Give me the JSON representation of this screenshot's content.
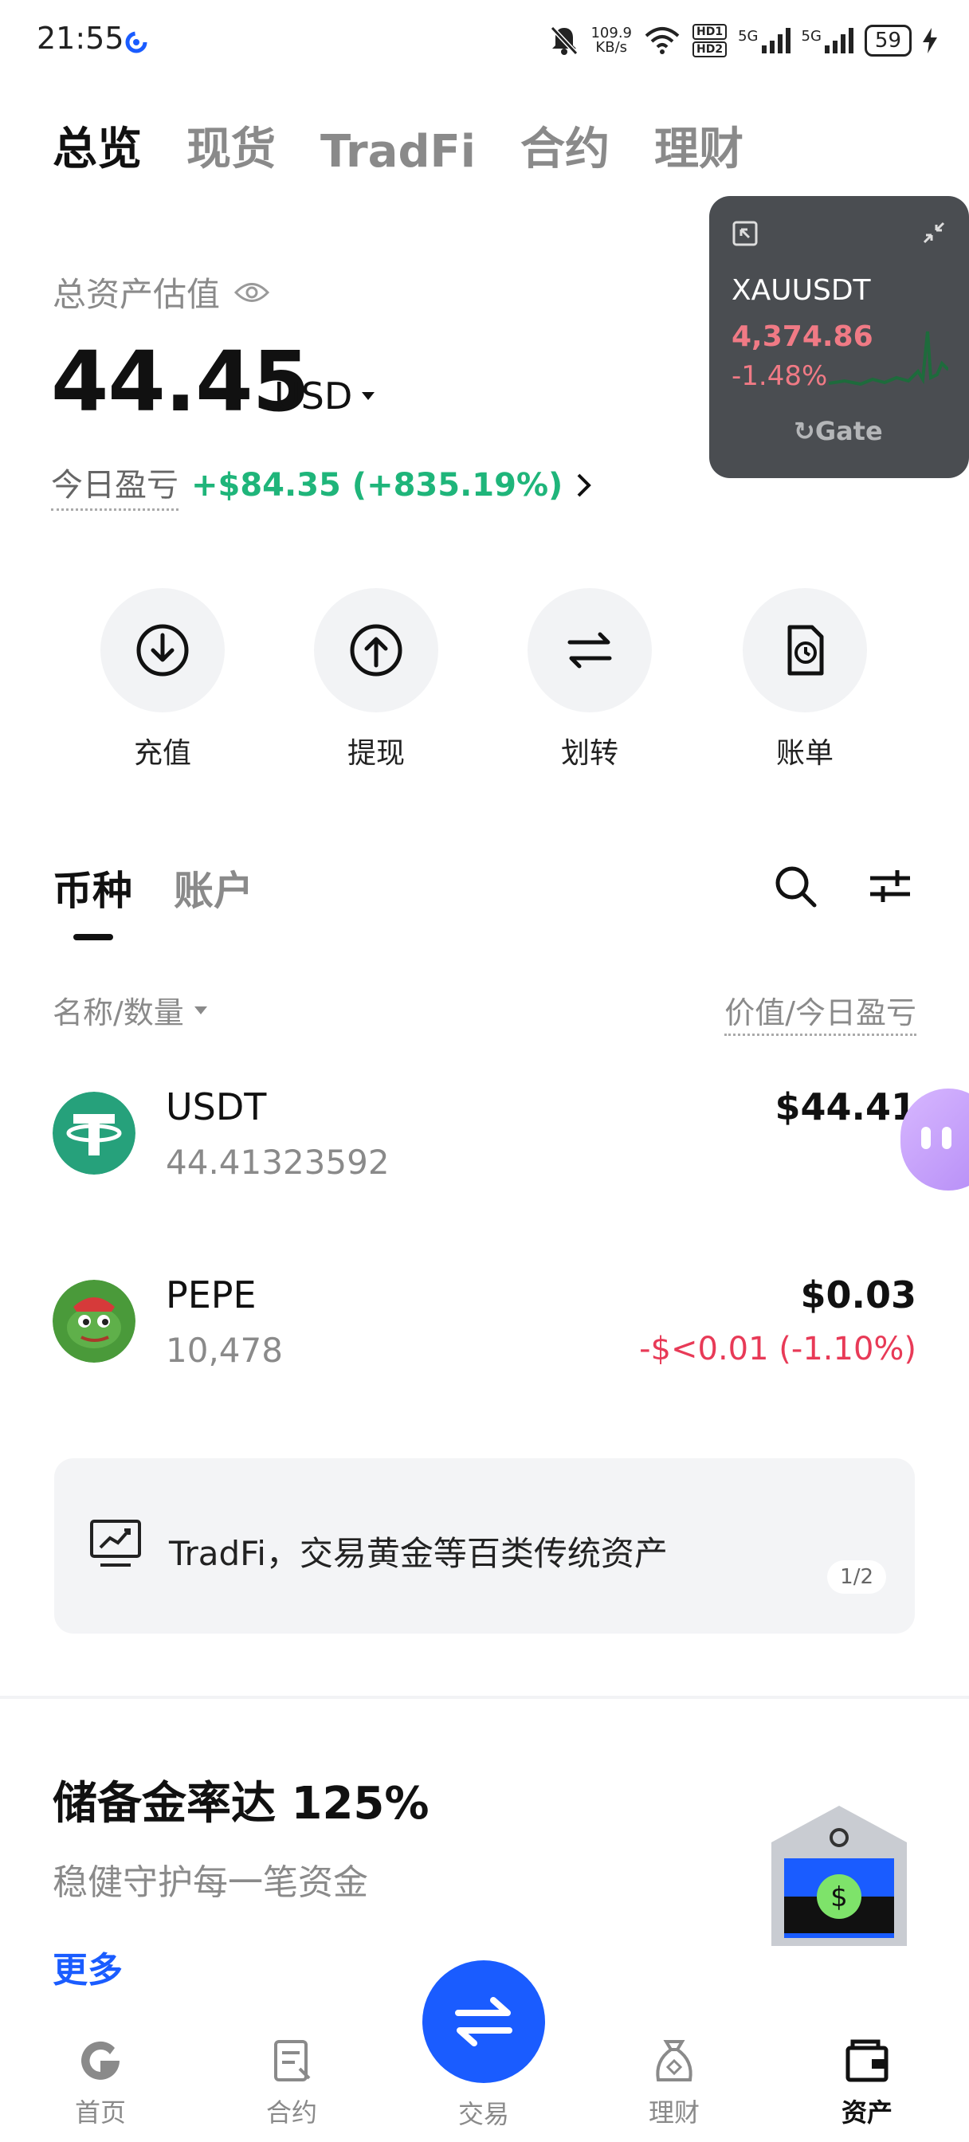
{
  "status_bar": {
    "time": "21:55",
    "net_speed_value": "109.9",
    "net_speed_unit": "KB/s",
    "hd1": "HD1",
    "hd2": "HD2",
    "sig1": "5G",
    "sig2": "5G",
    "battery": "59"
  },
  "top_tabs": [
    {
      "label": "总览",
      "active": true
    },
    {
      "label": "现货"
    },
    {
      "label": "TradFi"
    },
    {
      "label": "合约"
    },
    {
      "label": "理财"
    }
  ],
  "summary": {
    "label": "总资产估值",
    "value": "44.45",
    "currency": "USD",
    "pnl_label": "今日盈亏",
    "pnl_value": "+$84.35 (+835.19%)"
  },
  "ticker": {
    "pair": "XAUUSDT",
    "price": "4,374.86",
    "change": "-1.48%",
    "brand": "Gate"
  },
  "quick_actions": [
    {
      "label": "充值",
      "icon": "deposit-icon"
    },
    {
      "label": "提现",
      "icon": "withdraw-icon"
    },
    {
      "label": "划转",
      "icon": "transfer-icon"
    },
    {
      "label": "账单",
      "icon": "bill-icon"
    }
  ],
  "section_tabs": [
    {
      "label": "币种",
      "active": true
    },
    {
      "label": "账户"
    }
  ],
  "list_header": {
    "left": "名称/数量",
    "right": "价值/今日盈亏"
  },
  "assets": [
    {
      "name": "USDT",
      "quantity": "44.41323592",
      "value": "$44.41",
      "pnl": ""
    },
    {
      "name": "PEPE",
      "quantity": "10,478",
      "value": "$0.03",
      "pnl": "-$<0.01 (-1.10%)"
    }
  ],
  "banner": {
    "text": "TradFi，交易黄金等百类传统资产",
    "page": "1/2"
  },
  "reserve": {
    "title": "储备金率达 125%",
    "subtitle": "稳健守护每一笔资金",
    "more": "更多"
  },
  "bottom_nav": [
    {
      "label": "首页"
    },
    {
      "label": "合约"
    },
    {
      "label": "交易"
    },
    {
      "label": "理财"
    },
    {
      "label": "资产",
      "active": true
    }
  ],
  "colors": {
    "accent": "#1a5cff",
    "positive": "#1fb57a",
    "negative": "#e83a57",
    "usdt": "#26a17b",
    "ticker_bg": "#4a4d51"
  }
}
